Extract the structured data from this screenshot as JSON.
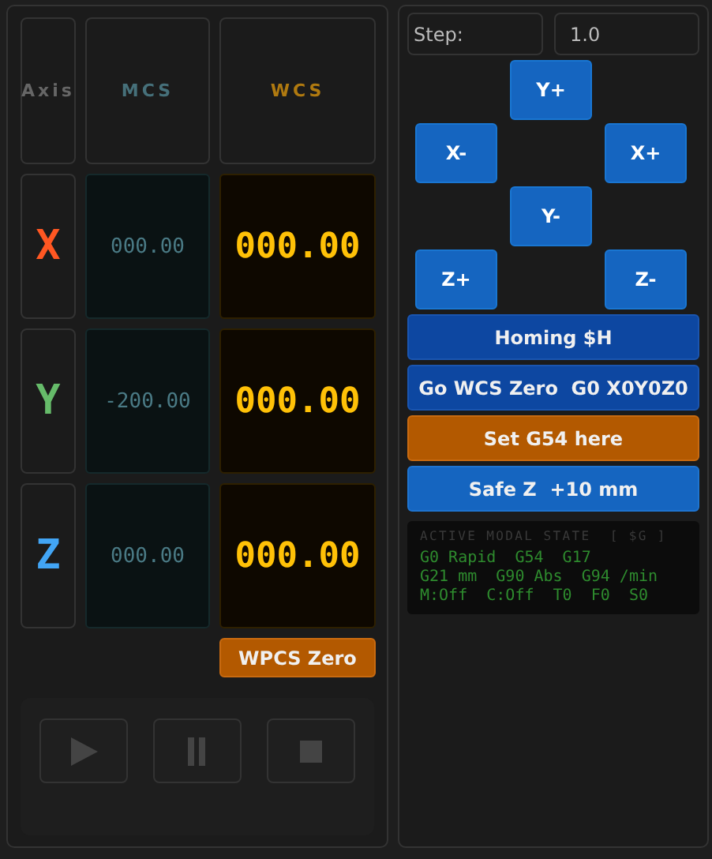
{
  "dro": {
    "headers": {
      "axis": "Axis",
      "mcs": "MCS",
      "wcs": "WCS"
    },
    "axes": [
      {
        "label": "X",
        "color": "#ff5722",
        "mcs": "000.00",
        "wcs": "000.00"
      },
      {
        "label": "Y",
        "color": "#66bb6a",
        "mcs": "-200.00",
        "wcs": "000.00"
      },
      {
        "label": "Z",
        "color": "#42a5f5",
        "mcs": "000.00",
        "wcs": "000.00"
      }
    ],
    "zero_button": "WPCS Zero"
  },
  "transport": [
    {
      "kind": "play",
      "disabled": true
    },
    {
      "kind": "pause",
      "disabled": true
    },
    {
      "kind": "stop",
      "disabled": true
    }
  ],
  "step": {
    "label": "Step:",
    "value": "1.0"
  },
  "jog": [
    {
      "label": "Y+"
    },
    {
      "label": "X-"
    },
    {
      "label": "X+"
    },
    {
      "label": "Y-"
    },
    {
      "label": "Z+"
    },
    {
      "label": "Z-"
    }
  ],
  "actions": [
    {
      "label": "Homing $H",
      "kind": "dark"
    },
    {
      "label": "Go WCS Zero  G0 X0Y0Z0",
      "kind": "dark"
    },
    {
      "label": "Set G54 here",
      "kind": "orange"
    },
    {
      "label": "Safe Z  +10 mm",
      "kind": "blue"
    }
  ],
  "modal_state": {
    "title": "ACTIVE MODAL STATE  [ $G ]",
    "lines": [
      "G0 Rapid  G54  G17",
      "G21 mm  G90 Abs  G94 /min",
      "M:Off  C:Off  T0  F0  S0"
    ]
  }
}
